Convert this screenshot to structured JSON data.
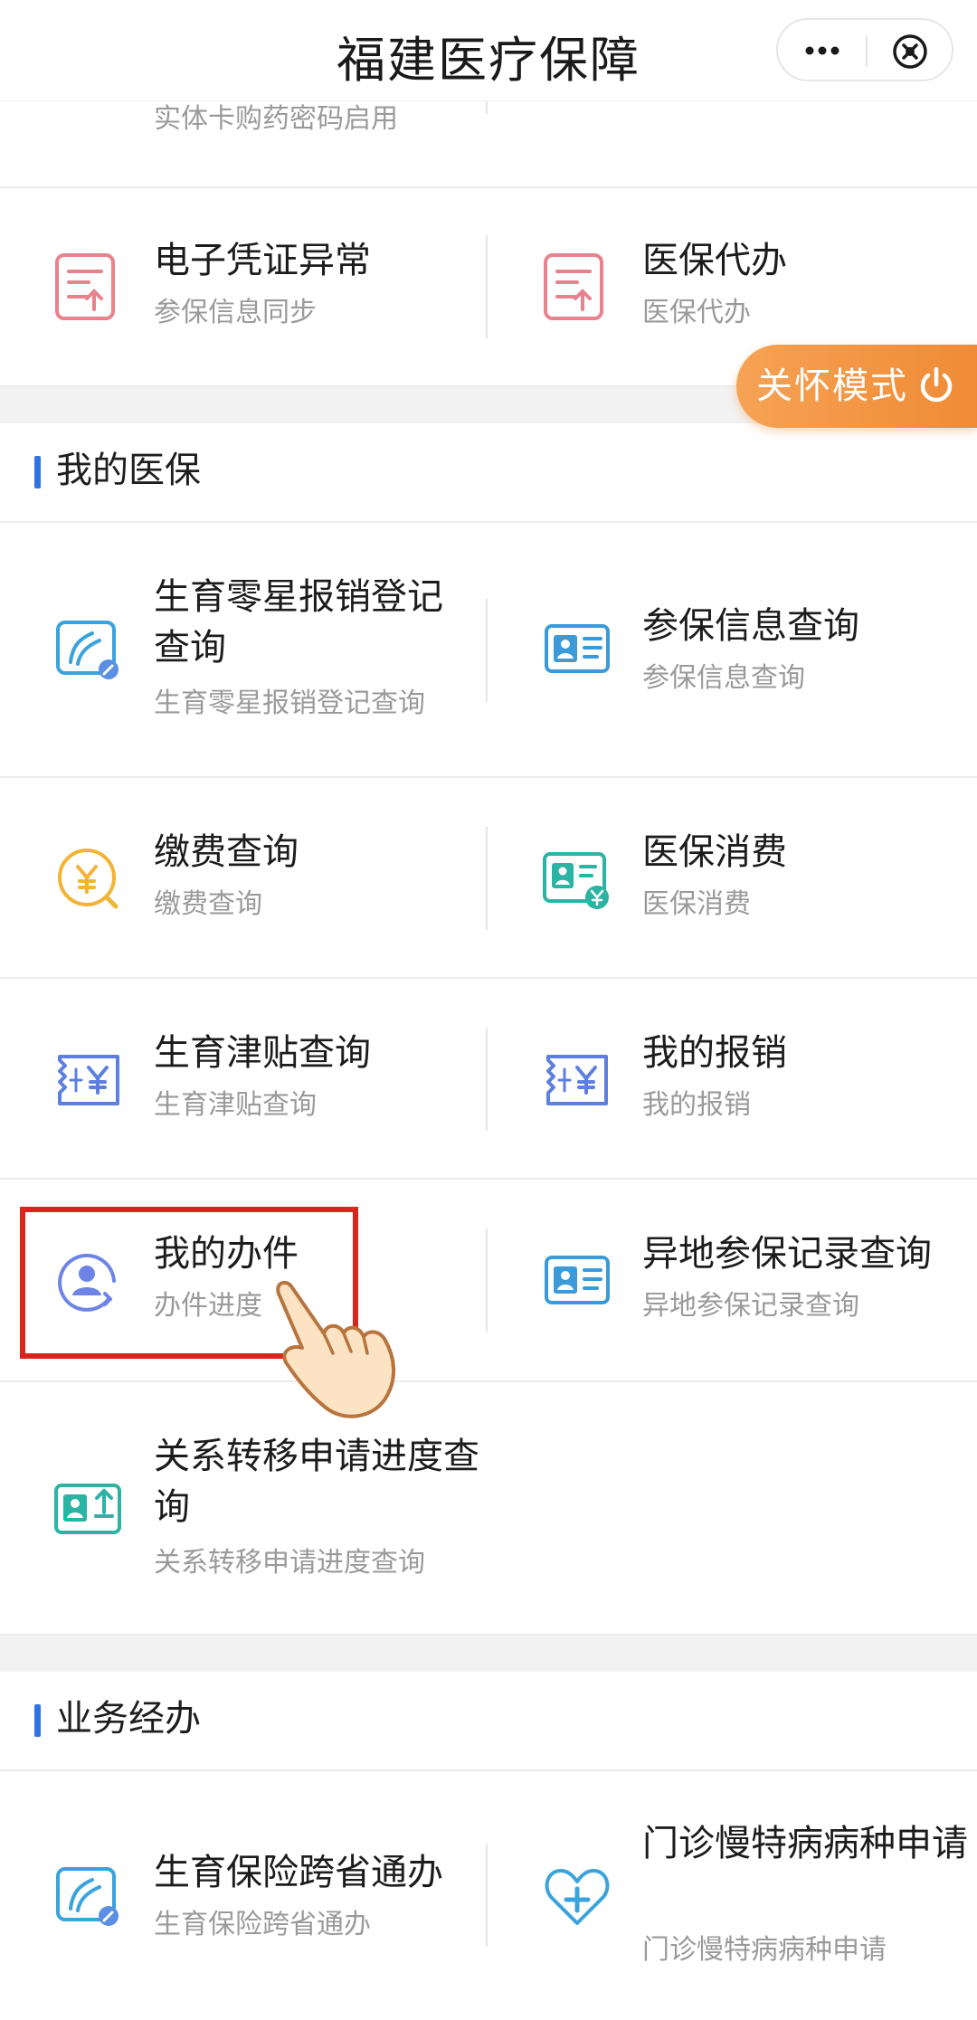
{
  "header": {
    "title": "福建医疗保障",
    "more_icon": "more-dots-icon",
    "close_icon": "close-circle-icon"
  },
  "top_partial": {
    "left_sub": "实体卡购药密码启用"
  },
  "rows": [
    {
      "left": {
        "title": "电子凭证异常",
        "sub": "参保信息同步",
        "icon": "document-upload-icon"
      },
      "right": {
        "title": "医保代办",
        "sub": "医保代办",
        "icon": "document-upload-icon"
      }
    }
  ],
  "care_mode": {
    "label": "关怀模式",
    "icon": "power-icon"
  },
  "section_my": {
    "title": "我的医保",
    "rows": [
      {
        "left": {
          "title": "生育零星报销登记查询",
          "sub": "生育零星报销登记查询",
          "icon": "maternity-card-icon"
        },
        "right": {
          "title": "参保信息查询",
          "sub": "参保信息查询",
          "icon": "id-card-icon"
        }
      },
      {
        "left": {
          "title": "缴费查询",
          "sub": "缴费查询",
          "icon": "yuan-coin-search-icon"
        },
        "right": {
          "title": "医保消费",
          "sub": "医保消费",
          "icon": "id-card-yuan-icon"
        }
      },
      {
        "left": {
          "title": "生育津贴查询",
          "sub": "生育津贴查询",
          "icon": "yuan-ticket-icon"
        },
        "right": {
          "title": "我的报销",
          "sub": "我的报销",
          "icon": "yuan-ticket-icon"
        }
      },
      {
        "left": {
          "title": "我的办件",
          "sub": "办件进度",
          "icon": "user-progress-icon"
        },
        "right": {
          "title": "异地参保记录查询",
          "sub": "异地参保记录查询",
          "icon": "id-card-icon"
        }
      },
      {
        "left": {
          "title": "关系转移申请进度查询",
          "sub": "关系转移申请进度查询",
          "icon": "id-card-upload-icon"
        }
      }
    ]
  },
  "section_business": {
    "title": "业务经办",
    "rows": [
      {
        "left": {
          "title": "生育保险跨省通办",
          "sub": "生育保险跨省通办",
          "icon": "maternity-card-icon"
        },
        "right": {
          "title": "门诊慢特病病种申请",
          "sub": "门诊慢特病病种申请",
          "icon": "heart-plus-icon"
        }
      }
    ]
  },
  "annotation": {
    "hand_icon": "pointing-hand-icon",
    "colors": {
      "highlight": "#d9251c",
      "accent": "#2f73e8",
      "care": "#f08b35"
    }
  }
}
